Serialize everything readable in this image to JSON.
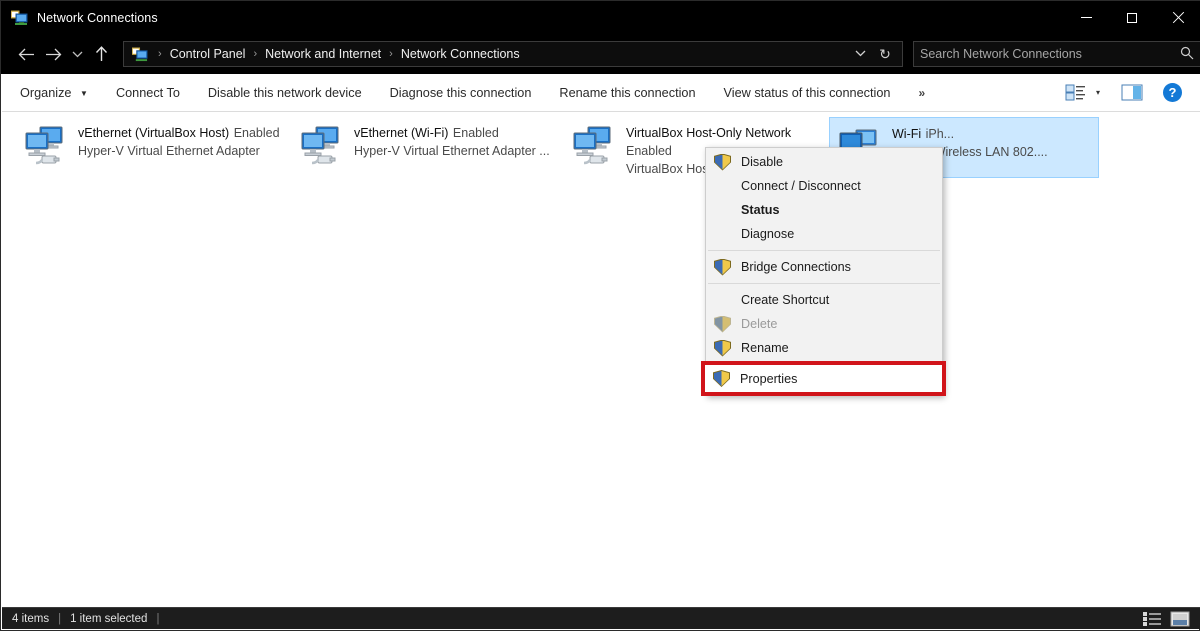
{
  "window": {
    "title": "Network Connections",
    "icon": "network-connections-icon",
    "controls": {
      "minimize": "minimize-icon",
      "maximize": "maximize-icon",
      "close": "close-icon"
    }
  },
  "address_bar": {
    "back": "back-arrow-icon",
    "forward": "forward-arrow-icon",
    "recent": "chevron-down-icon",
    "up": "up-arrow-icon",
    "breadcrumb": [
      "Control Panel",
      "Network and Internet",
      "Network Connections"
    ],
    "separator": "›",
    "dropdown": "chevron-down-icon",
    "refresh": "↻"
  },
  "search": {
    "placeholder": "Search Network Connections",
    "value": "",
    "icon": "search-icon"
  },
  "command_bar": {
    "items": [
      {
        "label": "Organize",
        "has_caret": true
      },
      {
        "label": "Connect To",
        "has_caret": false
      },
      {
        "label": "Disable this network device",
        "has_caret": false
      },
      {
        "label": "Diagnose this connection",
        "has_caret": false
      },
      {
        "label": "Rename this connection",
        "has_caret": false
      },
      {
        "label": "View status of this connection",
        "has_caret": false
      }
    ],
    "overflow": "»",
    "view_options_icon": "view-options-icon",
    "view_caret": "▾",
    "preview_pane_icon": "preview-pane-icon",
    "help_label": "?"
  },
  "connections": [
    {
      "name": "vEthernet (VirtualBox Host)",
      "status": "Enabled",
      "adapter": "Hyper-V Virtual Ethernet Adapter",
      "selected": false
    },
    {
      "name": "vEthernet (Wi-Fi)",
      "status": "Enabled",
      "adapter": "Hyper-V Virtual Ethernet Adapter ...",
      "selected": false
    },
    {
      "name": "VirtualBox Host-Only Network",
      "status": "Enabled",
      "adapter": "VirtualBox Host-Only Ethernet Ada...",
      "selected": false
    },
    {
      "name": "Wi-Fi",
      "status": "iPh...",
      "adapter": "822CE Wireless LAN 802....",
      "selected": true
    }
  ],
  "context_menu": {
    "items": [
      {
        "label": "Disable",
        "shield": true,
        "bold": false,
        "disabled": false
      },
      {
        "label": "Connect / Disconnect",
        "shield": false,
        "bold": false,
        "disabled": false
      },
      {
        "label": "Status",
        "shield": false,
        "bold": true,
        "disabled": false
      },
      {
        "label": "Diagnose",
        "shield": false,
        "bold": false,
        "disabled": false
      },
      {
        "separator": true
      },
      {
        "label": "Bridge Connections",
        "shield": true,
        "bold": false,
        "disabled": false
      },
      {
        "separator": true
      },
      {
        "label": "Create Shortcut",
        "shield": false,
        "bold": false,
        "disabled": false
      },
      {
        "label": "Delete",
        "shield": true,
        "bold": false,
        "disabled": true
      },
      {
        "label": "Rename",
        "shield": true,
        "bold": false,
        "disabled": false
      },
      {
        "separator": true
      }
    ],
    "highlighted_item": {
      "label": "Properties",
      "shield": true
    },
    "highlight_color": "#d1141a"
  },
  "status_bar": {
    "item_count": "4 items",
    "selection": "1 item selected",
    "separator": "|",
    "details_view_icon": "details-view-icon",
    "large_icons_view_icon": "large-icons-view-icon"
  },
  "colors": {
    "titlebar_bg": "#000000",
    "selection_bg": "#cce8ff",
    "accent": "#1379d6"
  }
}
